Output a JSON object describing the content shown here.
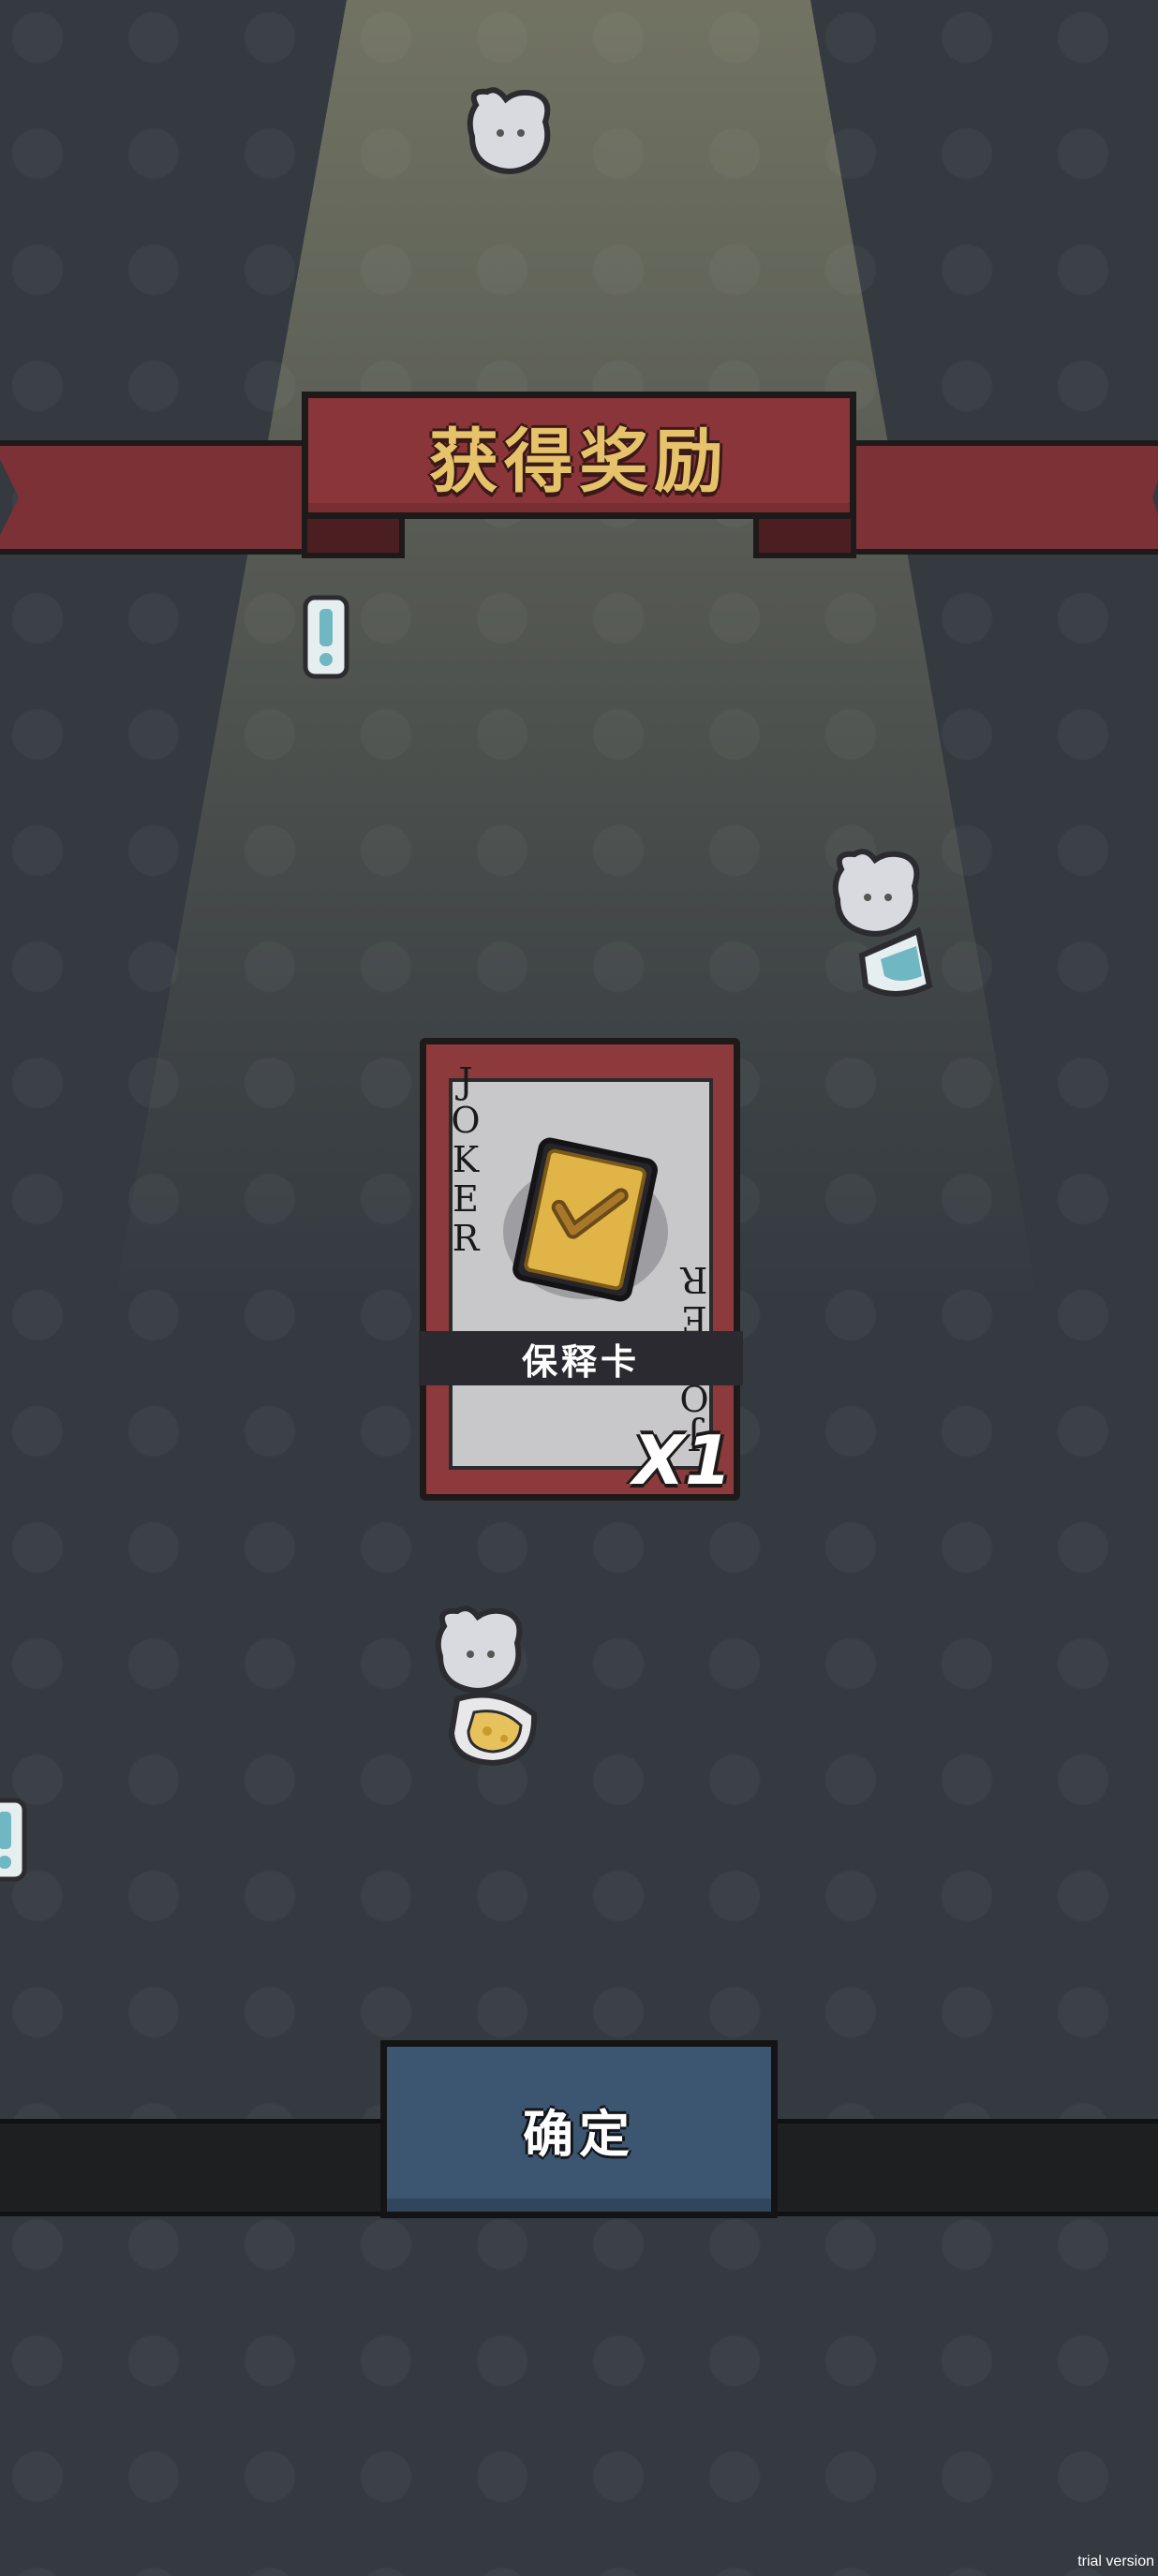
{
  "header": {
    "title": "获得奖励"
  },
  "reward_card": {
    "corner_top": "JOKER",
    "corner_bottom": "JOKER",
    "name": "保释卡",
    "count": "X1",
    "icon": "shield-check-icon"
  },
  "confirm_button": {
    "label": "确定"
  },
  "decorations": [
    "mouse-head-icon",
    "exclamation-icon",
    "mouse-with-shield-icon",
    "mouse-with-cheese-icon"
  ],
  "watermark": "trial version",
  "colors": {
    "background": "#343a40",
    "ribbon": "#8a3539",
    "title_text": "#e6c26a",
    "card_border": "#8d3a3c",
    "button": "#3c5672"
  }
}
